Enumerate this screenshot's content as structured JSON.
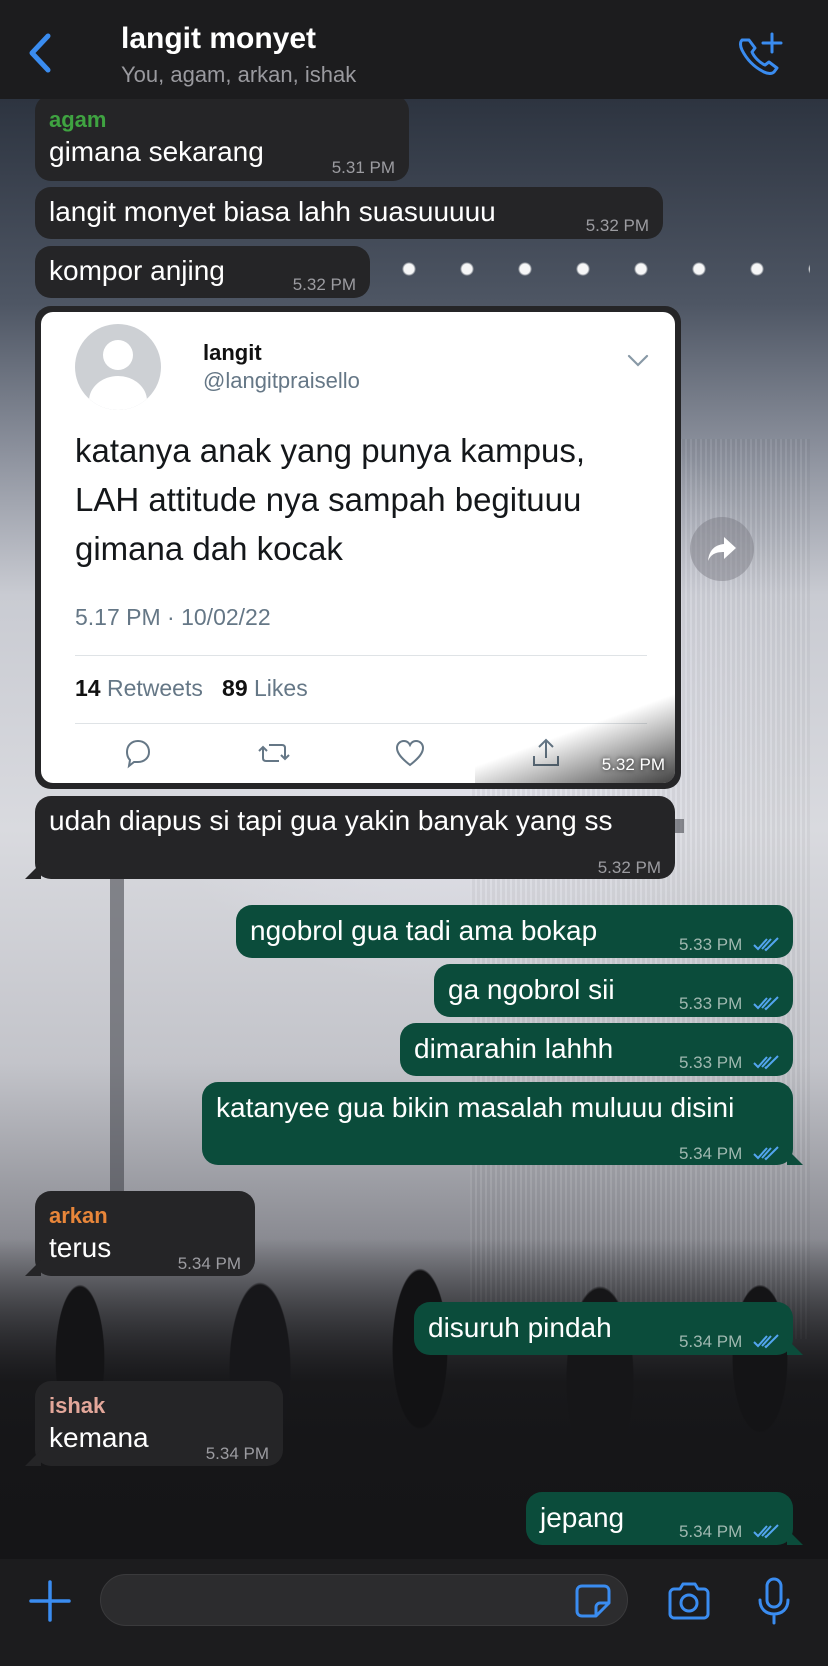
{
  "header": {
    "title": "langit monyet",
    "subtitle": "You, agam, arkan, ishak"
  },
  "colors": {
    "accent": "#3a8cf0",
    "incoming_bubble": "#252527",
    "outgoing_bubble": "#0b4c3b",
    "sender_agam": "#3fa341",
    "sender_arkan": "#e8863a",
    "sender_ishak": "#e3a79a"
  },
  "messages": {
    "m1": {
      "sender": "agam",
      "text": "gimana sekarang",
      "time": "5.31 PM"
    },
    "m2": {
      "text": "langit monyet biasa lahh suasuuuuu",
      "time": "5.32 PM"
    },
    "m3": {
      "text": "kompor anjing",
      "time": "5.32 PM"
    },
    "m4": {
      "text": "udah diapus si tapi gua yakin banyak yang ss",
      "time": "5.32 PM"
    },
    "m5": {
      "text": "ngobrol gua tadi ama bokap",
      "time": "5.33 PM"
    },
    "m6": {
      "text": "ga ngobrol sii",
      "time": "5.33 PM"
    },
    "m7": {
      "text": "dimarahin lahhh",
      "time": "5.33 PM"
    },
    "m8": {
      "text": "katanyee gua bikin masalah muluuu disini",
      "time": "5.34 PM"
    },
    "m9": {
      "sender": "arkan",
      "text": "terus",
      "time": "5.34 PM"
    },
    "m10": {
      "text": "disuruh pindah",
      "time": "5.34 PM"
    },
    "m11": {
      "sender": "ishak",
      "text": "kemana",
      "time": "5.34 PM"
    },
    "m12": {
      "text": "jepang",
      "time": "5.34 PM"
    }
  },
  "tweet": {
    "name": "langit",
    "handle": "@langitpraisello",
    "text": "katanya anak yang punya kampus, LAH attitude nya sampah begituuu gimana dah kocak",
    "date": "5.17 PM · 10/02/22",
    "retweets_count": "14",
    "retweets_label": "Retweets",
    "likes_count": "89",
    "likes_label": "Likes",
    "time": "5.32 PM"
  },
  "composer": {
    "placeholder": ""
  },
  "icons": {
    "back": "chevron-left-icon",
    "call": "add-call-icon",
    "forward": "forward-icon",
    "plus": "plus-icon",
    "sticker": "sticker-icon",
    "camera": "camera-icon",
    "mic": "mic-icon"
  }
}
